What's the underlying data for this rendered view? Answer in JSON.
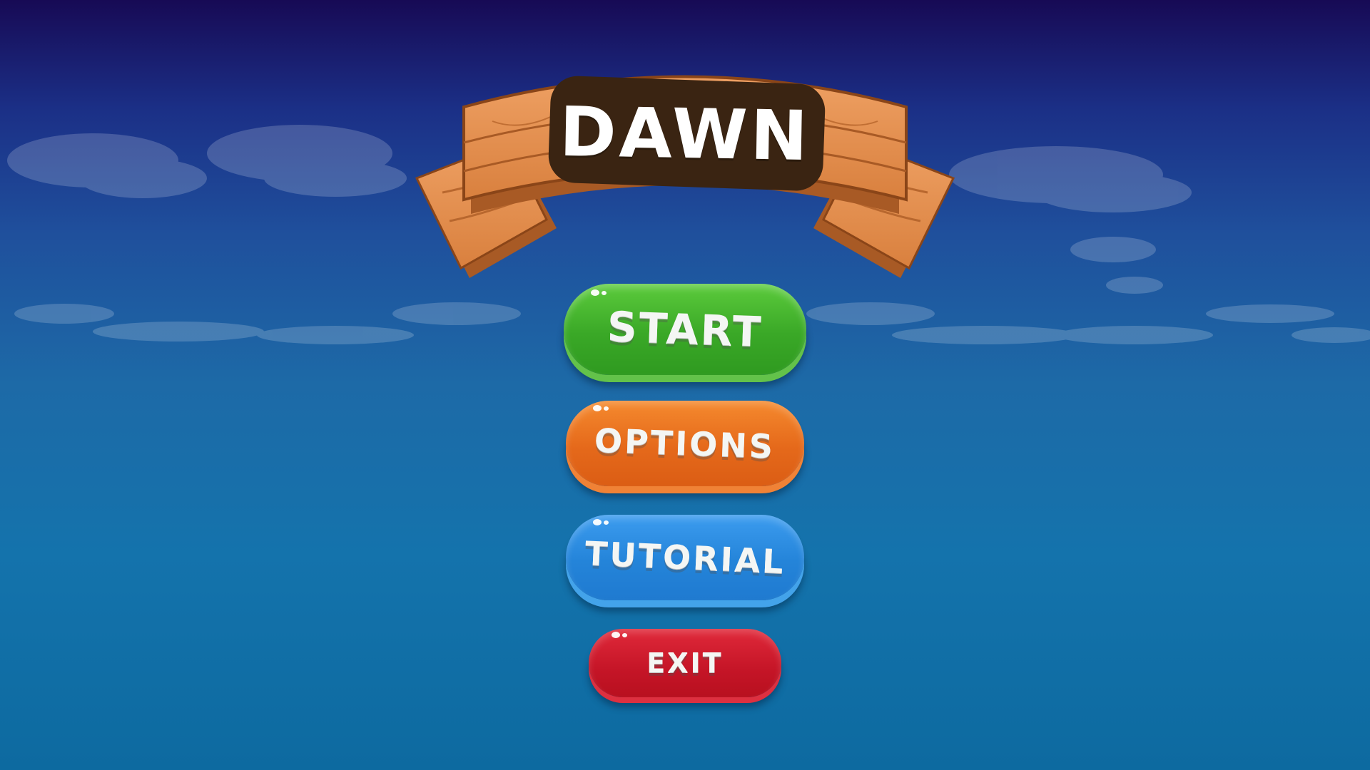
{
  "game": {
    "title": "DAWN"
  },
  "menu": {
    "start_label": "START",
    "options_label": "OPTIONS",
    "tutorial_label": "TUTORIAL",
    "exit_label": "EXIT"
  },
  "colors": {
    "sky_top": "#170a55",
    "sky_bottom": "#0d6aa0",
    "wood": "#e08a47",
    "wood_dark": "#b5612b",
    "title_plate": "#3a2412",
    "start": "#3aa827",
    "options": "#e5691b",
    "tutorial": "#2484d9",
    "exit": "#c51527"
  }
}
